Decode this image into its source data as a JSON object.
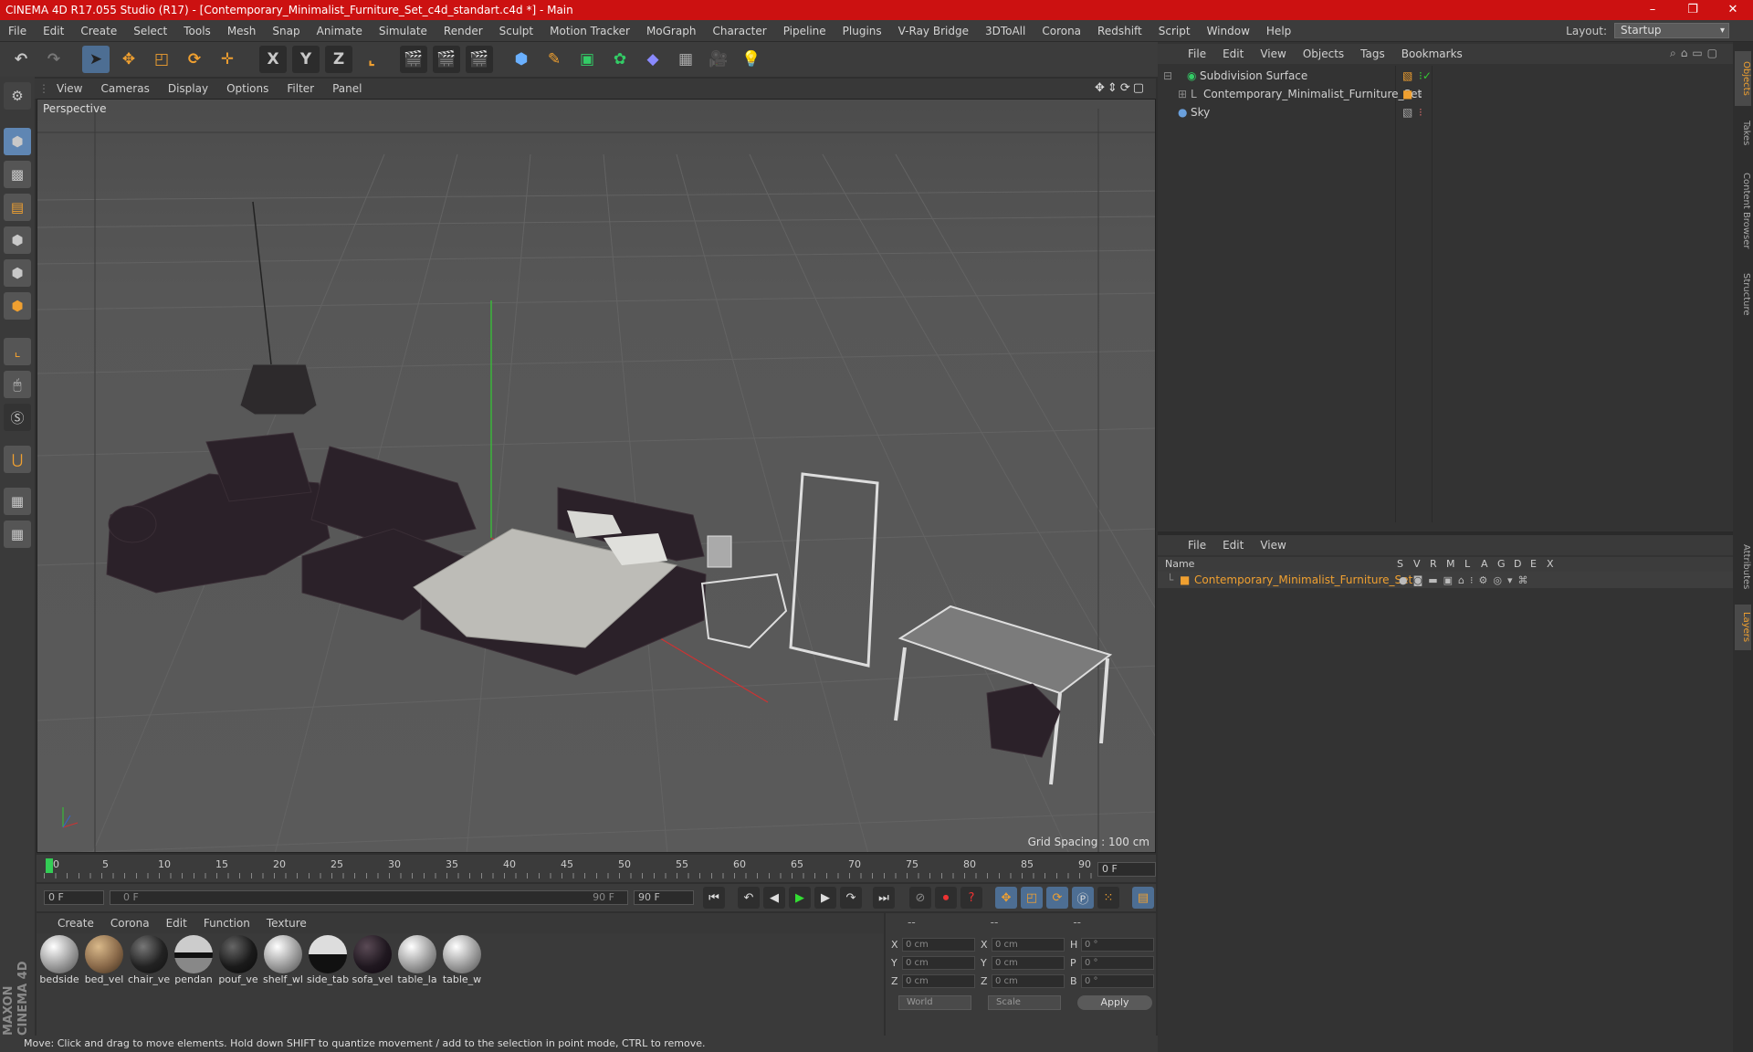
{
  "window": {
    "title": "CINEMA 4D R17.055 Studio (R17) - [Contemporary_Minimalist_Furniture_Set_c4d_standart.c4d *] - Main",
    "minimize": "–",
    "maximize": "❐",
    "close": "✕"
  },
  "menu": [
    "File",
    "Edit",
    "Create",
    "Select",
    "Tools",
    "Mesh",
    "Snap",
    "Animate",
    "Simulate",
    "Render",
    "Sculpt",
    "Motion Tracker",
    "MoGraph",
    "Character",
    "Pipeline",
    "Plugins",
    "V-Ray Bridge",
    "3DToAll",
    "Corona",
    "Redshift",
    "Script",
    "Window",
    "Help"
  ],
  "layout": {
    "label": "Layout:",
    "value": "Startup"
  },
  "toolbar": {
    "x_axis": "X",
    "y_axis": "Y",
    "z_axis": "Z"
  },
  "viewport": {
    "menu": [
      "View",
      "Cameras",
      "Display",
      "Options",
      "Filter",
      "Panel"
    ],
    "label": "Perspective",
    "grid_spacing": "Grid Spacing : 100 cm"
  },
  "timeline": {
    "ticks": [
      "0",
      "5",
      "10",
      "15",
      "20",
      "25",
      "30",
      "35",
      "40",
      "45",
      "50",
      "55",
      "60",
      "65",
      "70",
      "75",
      "80",
      "85",
      "90"
    ],
    "current_frame": "0 F"
  },
  "transport": {
    "start": "0 F",
    "range_start": "0 F",
    "range_end": "90 F",
    "end": "90 F"
  },
  "materials": {
    "menu": [
      "Create",
      "Corona",
      "Edit",
      "Function",
      "Texture"
    ],
    "items": [
      "bedside",
      "bed_vel",
      "chair_ve",
      "pendan",
      "pouf_ve",
      "shelf_wl",
      "side_tab",
      "sofa_vel",
      "table_la",
      "table_w"
    ]
  },
  "coords": {
    "head": [
      "--",
      "--",
      "--"
    ],
    "rows": [
      {
        "a1": "X",
        "v1": "0 cm",
        "a2": "X",
        "v2": "0 cm",
        "a3": "H",
        "v3": "0 °"
      },
      {
        "a1": "Y",
        "v1": "0 cm",
        "a2": "Y",
        "v2": "0 cm",
        "a3": "P",
        "v3": "0 °"
      },
      {
        "a1": "Z",
        "v1": "0 cm",
        "a2": "Z",
        "v2": "0 cm",
        "a3": "B",
        "v3": "0 °"
      }
    ],
    "space": "World",
    "mode": "Scale",
    "apply": "Apply"
  },
  "status": "Move: Click and drag to move elements. Hold down SHIFT to quantize movement / add to the selection in point mode, CTRL to remove.",
  "objects": {
    "menu": [
      "File",
      "Edit",
      "View",
      "Objects",
      "Tags",
      "Bookmarks"
    ],
    "items": [
      "Subdivision Surface",
      "Contemporary_Minimalist_Furniture_Set",
      "Sky"
    ]
  },
  "layers": {
    "menu": [
      "File",
      "Edit",
      "View"
    ],
    "name_col": "Name",
    "cols": [
      "S",
      "V",
      "R",
      "M",
      "L",
      "A",
      "G",
      "D",
      "E",
      "X"
    ],
    "item": "Contemporary_Minimalist_Furniture_Set"
  },
  "side_tabs": [
    "Objects",
    "Takes",
    "Content Browser",
    "Structure",
    "Attributes",
    "Layers"
  ],
  "brand": "MAXON CINEMA 4D",
  "colors": {
    "title_bar": "#cc1111",
    "accent": "#f0a030",
    "axis_x": "#cc3333",
    "axis_y": "#33cc33",
    "axis_z": "#3366cc"
  }
}
